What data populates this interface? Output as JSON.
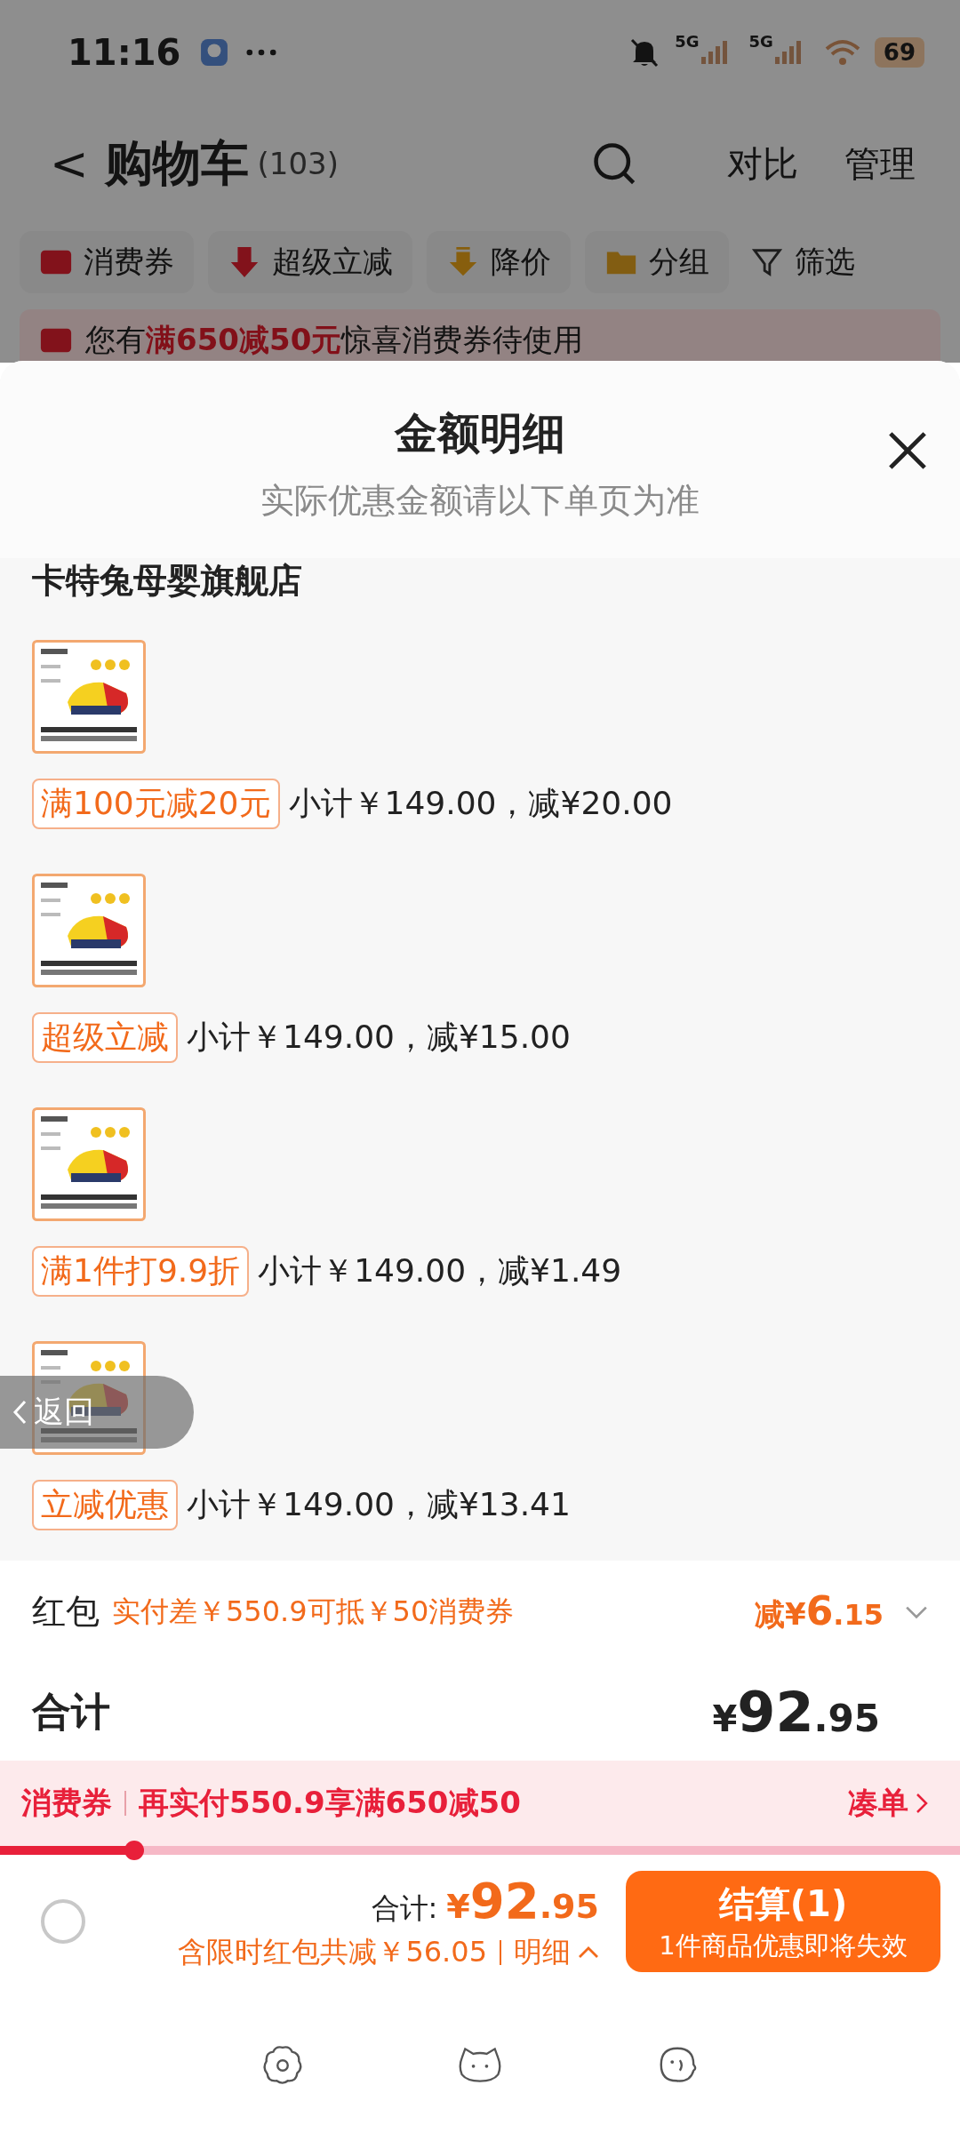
{
  "status_bar": {
    "time": "11:16",
    "network_1": "5G",
    "network_2": "5G",
    "battery": "69"
  },
  "header": {
    "back": "<",
    "title": "购物车",
    "count": "(103)",
    "actions": [
      "对比",
      "管理"
    ]
  },
  "filters": [
    {
      "label": "消费券",
      "kind": "ticket"
    },
    {
      "label": "超级立减",
      "kind": "arrow"
    },
    {
      "label": "降价",
      "kind": "drop"
    },
    {
      "label": "分组",
      "kind": "folder"
    },
    {
      "label": "筛选",
      "kind": "funnel"
    }
  ],
  "notice": "您有**满650减50元**惊喜消费券待使用",
  "sheet": {
    "title": "金额明细",
    "subtitle": "实际优惠金额请以下单页为准",
    "store": "卡特兔母婴旗舰店",
    "items": [
      {
        "kind": "picture",
        "tag": "满100元减20元",
        "subtotal": "小计￥149.00，减¥20.00"
      },
      {
        "kind": "picture",
        "tag": "超级立减",
        "subtotal": "小计￥149.00，减¥15.00"
      },
      {
        "kind": "picture",
        "tag": "满1件打9.9折",
        "subtotal": "小计￥149.00，减¥1.49"
      },
      {
        "kind": "picture",
        "tag": "立减优惠",
        "subtotal": "小计￥149.00，减¥13.41"
      }
    ],
    "red_packet": {
      "label": "红包",
      "note": "实付差￥550.9可抵￥50消费券",
      "amount": "减¥6.15"
    },
    "total": {
      "label": "合计",
      "amount": "¥92.95"
    }
  },
  "coupon_bar": {
    "label": "消费券",
    "text": "再实付550.9享满650减50",
    "action": "凑单",
    "level": 0.14
  },
  "checkout": {
    "checked": false,
    "total_label": "合计:",
    "total": "¥92.95",
    "saving": "含限时红包共减￥56.05",
    "detail": "明细",
    "button": "结算(1)",
    "button_note": "1件商品优惠即将失效"
  },
  "floating_back": "返回"
}
